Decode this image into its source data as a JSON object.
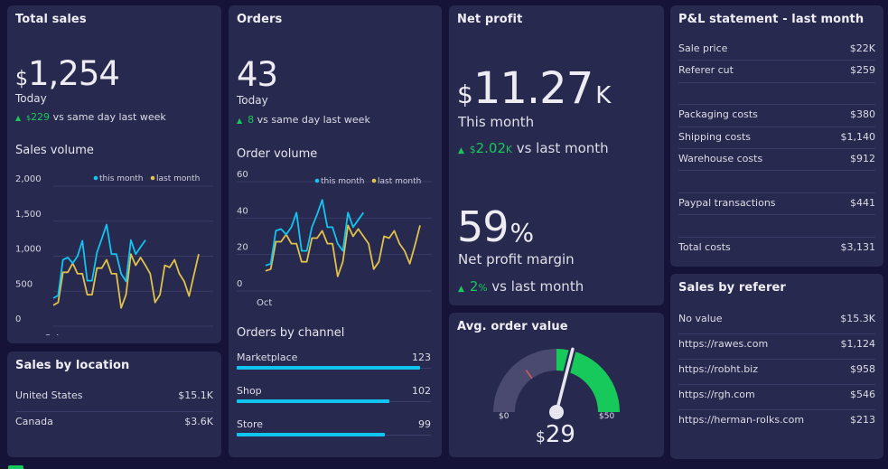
{
  "colors": {
    "background": "#161338",
    "card": "#28294f",
    "accent_blue": "#12c4f0",
    "accent_yellow": "#e0c14a",
    "positive_green": "#17c95a",
    "gauge_track": "#4a4a70",
    "gauge_red_marker": "#e05a5a"
  },
  "total_sales": {
    "title": "Total sales",
    "currency": "$",
    "value": "1,254",
    "period": "Today",
    "delta_icon": "triangle-up-icon",
    "delta_currency": "$",
    "delta_value": "229",
    "delta_text": "vs same day last week",
    "chart_title": "Sales volume"
  },
  "orders": {
    "title": "Orders",
    "value": "43",
    "period": "Today",
    "delta_icon": "triangle-up-icon",
    "delta_value": "8",
    "delta_text": "vs same day last week",
    "chart_title": "Order volume"
  },
  "orders_by_channel": {
    "title": "Orders by channel",
    "max": 130,
    "items": [
      {
        "label": "Marketplace",
        "value": 123
      },
      {
        "label": "Shop",
        "value": 102
      },
      {
        "label": "Store",
        "value": 99
      }
    ]
  },
  "sales_by_location": {
    "title": "Sales by location",
    "rows": [
      {
        "label": "United States",
        "value": "$15.1K"
      },
      {
        "label": "Canada",
        "value": "$3.6K"
      }
    ]
  },
  "net_profit": {
    "title": "Net profit",
    "currency": "$",
    "value": "11.27",
    "unit": "K",
    "period": "This month",
    "delta_icon": "triangle-up-icon",
    "delta_currency": "$",
    "delta_value": "2.02",
    "delta_unit": "K",
    "delta_text": "vs last month",
    "margin_value": "59",
    "margin_unit": "%",
    "margin_label": "Net profit margin",
    "margin_delta_value": "2",
    "margin_delta_unit": "%",
    "margin_delta_text": "vs last month"
  },
  "avg_order_value": {
    "title": "Avg. order value",
    "min_label": "$0",
    "max_label": "$50",
    "currency": "$",
    "value_label": "29",
    "gauge": {
      "min": 0,
      "max": 50,
      "value": 29,
      "target": 15,
      "green_from": 25
    }
  },
  "pl_statement": {
    "title": "P&L statement - last month",
    "rows": [
      {
        "label": "Sale price",
        "value": "$22K"
      },
      {
        "label": "Referer cut",
        "value": "$259"
      },
      {
        "label": "",
        "value": ""
      },
      {
        "label": "Packaging costs",
        "value": "$380"
      },
      {
        "label": "Shipping costs",
        "value": "$1,140"
      },
      {
        "label": "Warehouse costs",
        "value": "$912"
      },
      {
        "label": "",
        "value": ""
      },
      {
        "label": "Paypal transactions",
        "value": "$441"
      },
      {
        "label": "",
        "value": ""
      },
      {
        "label": "Total costs",
        "value": "$3,131"
      }
    ]
  },
  "sales_by_referer": {
    "title": "Sales by referer",
    "rows": [
      {
        "label": "No value",
        "value": "$15.3K"
      },
      {
        "label": "https://rawes.com",
        "value": "$1,124"
      },
      {
        "label": "https://robht.biz",
        "value": "$958"
      },
      {
        "label": "https://rgh.com",
        "value": "$546"
      },
      {
        "label": "https://herman-rolks.com",
        "value": "$213"
      }
    ]
  },
  "chart_data": [
    {
      "type": "line",
      "title": "Sales volume",
      "xlabel": "",
      "ylabel": "",
      "x_tick_labels": [
        "Oct"
      ],
      "y_ticks": [
        0,
        500,
        1000,
        1500,
        2000
      ],
      "y_tick_labels": [
        "0",
        "500",
        "1,000",
        "1,500",
        "2,000"
      ],
      "ylim": [
        0,
        2000
      ],
      "x_count": 31,
      "grid": true,
      "legend_position": "top-right",
      "series": [
        {
          "name": "this month",
          "color": "#12c4f0",
          "values": [
            400,
            440,
            950,
            980,
            900,
            1000,
            1220,
            650,
            650,
            1050,
            1250,
            1450,
            1030,
            1030,
            750,
            640,
            1230,
            1030,
            1130,
            1230
          ]
        },
        {
          "name": "last month",
          "color": "#e0c14a",
          "values": [
            300,
            340,
            770,
            770,
            900,
            750,
            750,
            450,
            450,
            830,
            830,
            950,
            750,
            750,
            260,
            450,
            1030,
            870,
            980,
            870,
            750,
            340,
            450,
            870,
            840,
            950,
            750,
            640,
            430,
            730,
            1030
          ]
        }
      ]
    },
    {
      "type": "line",
      "title": "Order volume",
      "xlabel": "",
      "ylabel": "",
      "x_tick_labels": [
        "Oct"
      ],
      "y_ticks": [
        0,
        20,
        40,
        60
      ],
      "y_tick_labels": [
        "0",
        "20",
        "40",
        "60"
      ],
      "ylim": [
        0,
        60
      ],
      "x_count": 31,
      "grid": true,
      "legend_position": "top-right",
      "series": [
        {
          "name": "this month",
          "color": "#12c4f0",
          "values": [
            14,
            15,
            33,
            34,
            31,
            35,
            43,
            22,
            22,
            35,
            42,
            50,
            35,
            35,
            26,
            22,
            43,
            35,
            39,
            43
          ]
        },
        {
          "name": "last month",
          "color": "#e0c14a",
          "values": [
            11,
            12,
            27,
            27,
            31,
            26,
            26,
            16,
            16,
            29,
            29,
            33,
            26,
            26,
            8,
            16,
            36,
            30,
            34,
            30,
            26,
            12,
            16,
            30,
            29,
            33,
            26,
            22,
            15,
            25,
            36
          ]
        }
      ]
    }
  ]
}
